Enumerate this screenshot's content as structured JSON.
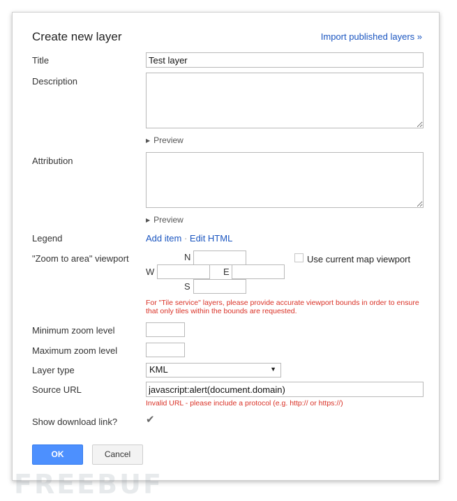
{
  "dialog": {
    "title": "Create new layer",
    "import_link": "Import published layers »"
  },
  "fields": {
    "title_label": "Title",
    "title_value": "Test layer",
    "description_label": "Description",
    "description_value": "",
    "attribution_label": "Attribution",
    "attribution_value": "",
    "preview_label": "Preview",
    "legend_label": "Legend",
    "legend_add_item": "Add item",
    "legend_separator": "·",
    "legend_edit_html": "Edit HTML",
    "viewport_label": "\"Zoom to area\" viewport",
    "viewport": {
      "n_label": "N",
      "w_label": "W",
      "e_label": "E",
      "s_label": "S",
      "n_value": "",
      "w_value": "",
      "e_value": "",
      "s_value": "",
      "use_current_label": "Use current map viewport",
      "use_current_checked": false
    },
    "viewport_help": "For \"Tile service\" layers, please provide accurate viewport bounds in order to ensure that only tiles within the bounds are requested.",
    "min_zoom_label": "Minimum zoom level",
    "min_zoom_value": "",
    "max_zoom_label": "Maximum zoom level",
    "max_zoom_value": "",
    "layer_type_label": "Layer type",
    "layer_type_value": "KML",
    "source_url_label": "Source URL",
    "source_url_value": "javascript:alert(document.domain)",
    "source_url_error": "Invalid URL - please include a protocol (e.g. http:// or https://)",
    "show_download_label": "Show download link?",
    "show_download_checked": true
  },
  "buttons": {
    "ok": "OK",
    "cancel": "Cancel"
  },
  "watermark": "FREEBUF",
  "colors": {
    "link": "#1a55c0",
    "error": "#d93025",
    "primary_button": "#4d90fe"
  }
}
